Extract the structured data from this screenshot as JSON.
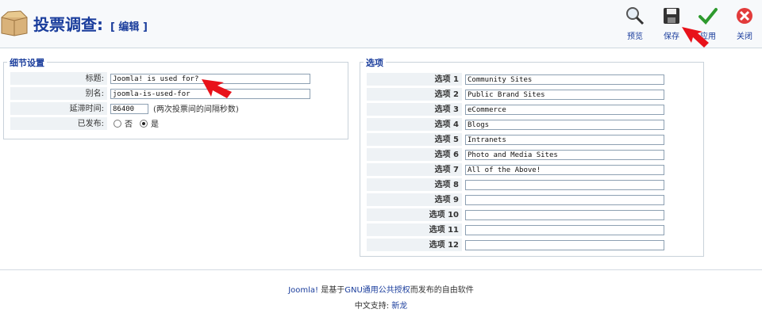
{
  "header": {
    "title": "投票调查:",
    "subtitle": "[ 编辑 ]"
  },
  "toolbar": {
    "preview": "预览",
    "save": "保存",
    "apply": "应用",
    "close": "关闭"
  },
  "details": {
    "legend": "细节设置",
    "title_label": "标题:",
    "title_value": "Joomla! is used for?",
    "alias_label": "别名:",
    "alias_value": "joomla-is-used-for",
    "lag_label": "延滞时间:",
    "lag_value": "86400",
    "lag_hint": "(两次投票间的间隔秒数)",
    "published_label": "已发布:",
    "no": "否",
    "yes": "是"
  },
  "options": {
    "legend": "选项",
    "items": [
      {
        "label": "选项 1",
        "value": "Community Sites"
      },
      {
        "label": "选项 2",
        "value": "Public Brand Sites"
      },
      {
        "label": "选项 3",
        "value": "eCommerce"
      },
      {
        "label": "选项 4",
        "value": "Blogs"
      },
      {
        "label": "选项 5",
        "value": "Intranets"
      },
      {
        "label": "选项 6",
        "value": "Photo and Media Sites"
      },
      {
        "label": "选项 7",
        "value": "All of the Above!"
      },
      {
        "label": "选项 8",
        "value": ""
      },
      {
        "label": "选项 9",
        "value": ""
      },
      {
        "label": "选项 10",
        "value": ""
      },
      {
        "label": "选项 11",
        "value": ""
      },
      {
        "label": "选项 12",
        "value": ""
      }
    ]
  },
  "footer": {
    "joomla": "Joomla!",
    "mid": " 是基于",
    "license": "GNU通用公共授权",
    "end": "而发布的自由软件",
    "support_label": "中文支持: ",
    "support_link": "新龙"
  }
}
